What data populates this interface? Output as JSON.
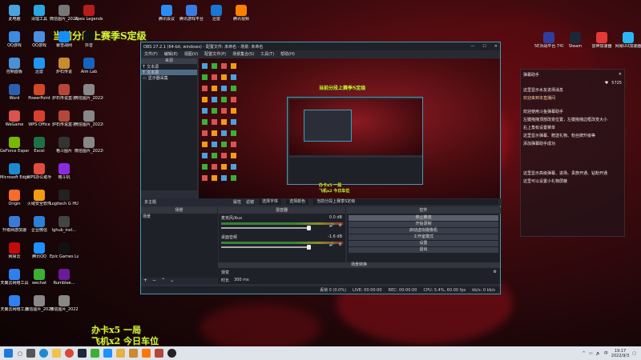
{
  "desktop_icons": [
    {
      "label": "此电脑",
      "color": "#4aa3df",
      "x": 0,
      "y": 0
    },
    {
      "label": "QQ游戏",
      "color": "#3c8be0",
      "x": 0,
      "y": 1
    },
    {
      "label": "控制面板",
      "color": "#4a90d6",
      "x": 0,
      "y": 2
    },
    {
      "label": "Word",
      "color": "#2b5fb0",
      "x": 0,
      "y": 3
    },
    {
      "label": "WeGame",
      "color": "#d9534f",
      "x": 0,
      "y": 4
    },
    {
      "label": "GeForce Experience",
      "color": "#76b900",
      "x": 0,
      "y": 5
    },
    {
      "label": "Microsoft Edge",
      "color": "#1b8bd1",
      "x": 0,
      "y": 6
    },
    {
      "label": "Origin",
      "color": "#f56c2d",
      "x": 0,
      "y": 7
    },
    {
      "label": "升级网游加速",
      "color": "#3a7bd5",
      "x": 0,
      "y": 8
    },
    {
      "label": "网易云",
      "color": "#c20c0c",
      "x": 0,
      "y": 9
    },
    {
      "label": "天翼云网络工具",
      "color": "#2f80ed",
      "x": 0,
      "y": 10
    },
    {
      "label": "天翼云网络工具",
      "color": "#2f80ed",
      "x": 0,
      "y": 11
    },
    {
      "label": "清理工具",
      "color": "#2aa7e0",
      "x": 1,
      "y": 0
    },
    {
      "label": "QQ游戏",
      "color": "#4a90e2",
      "x": 1,
      "y": 1
    },
    {
      "label": "迅雷",
      "color": "#2196f3",
      "x": 1,
      "y": 2
    },
    {
      "label": "PowerPoint",
      "color": "#d24726",
      "x": 1,
      "y": 3
    },
    {
      "label": "WPS Office",
      "color": "#d6402f",
      "x": 1,
      "y": 4
    },
    {
      "label": "Excel",
      "color": "#1e7145",
      "x": 1,
      "y": 5
    },
    {
      "label": "WPS办公助手",
      "color": "#e14c3e",
      "x": 1,
      "y": 6
    },
    {
      "label": "火绒安全软件",
      "color": "#f39c12",
      "x": 1,
      "y": 7
    },
    {
      "label": "企业微信",
      "color": "#2b80d8",
      "x": 1,
      "y": 8
    },
    {
      "label": "腾讯QQ",
      "color": "#1e90ff",
      "x": 1,
      "y": 9
    },
    {
      "label": "wechat",
      "color": "#3cb034",
      "x": 1,
      "y": 10
    },
    {
      "label": "微信图片_2022",
      "color": "#888888",
      "x": 1,
      "y": 11
    },
    {
      "label": "微信图片_2022012...",
      "color": "#777777",
      "x": 2,
      "y": 0
    },
    {
      "label": "暴雪战网",
      "color": "#148eff",
      "x": 2,
      "y": 1
    },
    {
      "label": "炉石传说",
      "color": "#c98b2e",
      "x": 2,
      "y": 2
    },
    {
      "label": "炉石传说盒子",
      "color": "#b5473a",
      "x": 2,
      "y": 3
    },
    {
      "label": "炉石传说盒子",
      "color": "#b5473a",
      "x": 2,
      "y": 4
    },
    {
      "label": "格斗图片",
      "color": "#333333",
      "x": 2,
      "y": 5
    },
    {
      "label": "格斗机",
      "color": "#8a2be2",
      "x": 2,
      "y": 6
    },
    {
      "label": "Logitech G HUB",
      "color": "#222222",
      "x": 2,
      "y": 7
    },
    {
      "label": "lghub_inst...",
      "color": "#444444",
      "x": 2,
      "y": 8
    },
    {
      "label": "Epic Games Launcher",
      "color": "#111111",
      "x": 2,
      "y": 9
    },
    {
      "label": "Rumblee...",
      "color": "#6a1b9a",
      "x": 2,
      "y": 10
    },
    {
      "label": "微信图片_2022",
      "color": "#888888",
      "x": 2,
      "y": 11
    },
    {
      "label": "Apex Legends",
      "color": "#b71c1c",
      "x": 3,
      "y": 0
    },
    {
      "label": "抖音",
      "color": "#111111",
      "x": 3,
      "y": 1
    },
    {
      "label": "Aim Lab",
      "color": "#1565c0",
      "x": 3,
      "y": 2
    },
    {
      "label": "微信图片_2022082...",
      "color": "#888888",
      "x": 3,
      "y": 3
    },
    {
      "label": "微信图片_2022082...",
      "color": "#888888",
      "x": 3,
      "y": 4
    },
    {
      "label": "微信图片_2022082...",
      "color": "#888888",
      "x": 3,
      "y": 5
    }
  ],
  "top_icons": [
    {
      "label": "腾讯会议",
      "color": "#2c8cf4"
    },
    {
      "label": "腾讯游戏平台",
      "color": "#3a7be0"
    },
    {
      "label": "迅雷",
      "color": "#1976d2"
    },
    {
      "label": "腾讯视频",
      "color": "#ff7f00"
    }
  ],
  "right_icons": [
    {
      "label": "5E对战平台 741",
      "color": "#2f3e9e"
    },
    {
      "label": "Steam",
      "color": "#1b2838"
    },
    {
      "label": "雷神加速器",
      "color": "#e53935"
    },
    {
      "label": "网易UU加速器",
      "color": "#29b6f6"
    }
  ],
  "overlay": {
    "title": "当前分段上赛季S定级",
    "line1": "办卡x5 一局",
    "line2": "飞机x2 今日车位"
  },
  "obs": {
    "title": "OBS 27.2.1 (64-bit, windows) - 配置文件: 未命名 - 场景: 未命名",
    "menu": [
      "文件(F)",
      "编辑(E)",
      "视图(V)",
      "配置文件(P)",
      "场景集合(S)",
      "工具(T)",
      "帮助(H)"
    ],
    "sources_header": "来源",
    "sources": [
      {
        "label": "文本源",
        "selected": false
      },
      {
        "label": "文本源",
        "selected": true
      },
      {
        "label": "显示器采集",
        "selected": false
      }
    ],
    "scene_bar": {
      "current": "多主题",
      "properties": "属性",
      "filters": "滤镜",
      "pick_font": "选择字体",
      "pick_color": "选择颜色",
      "text": "当前分段上赛季S定级"
    },
    "dock_headers": [
      "场景",
      "混音器",
      "控件"
    ],
    "scenes": [
      "场景"
    ],
    "mixer": [
      {
        "name": "麦克风/Aux",
        "db": "0.0 dB"
      },
      {
        "name": "桌面音频",
        "db": "-1.6 dB"
      }
    ],
    "controls": [
      "停止推流",
      "开始录制",
      "启动虚拟摄像机",
      "工作室模式",
      "设置",
      "退出"
    ],
    "transitions_header": "场景转换",
    "transition": "渐变",
    "duration_label": "时长",
    "duration": "300 ms",
    "status": [
      "丢帧 0 (0.0%)",
      "LIVE: 00:00:00",
      "REC: 00:00:00",
      "CPU: 5.4%, 60.00 fps",
      "kb/s: 0 kb/s"
    ]
  },
  "chat": {
    "header": "弹幕助手",
    "line1": "这里显示水友进场消息",
    "line2": "欢迎来到本直播间",
    "line3": "欢迎使用斗鱼弹幕助手",
    "line4": "左键拖拽顶部改变位置，左键拖拽边框改变大小",
    "line5": "右上角有设置菜单",
    "line6": "这里显示弹幕、赠送礼物、粉丝牌升级等",
    "line7": "添加弹幕助手成功",
    "line8": "这里显示高级弹幕、进场、贵族开通、钻粉开通",
    "line9": "这里可以设置小礼物屏蔽",
    "online": "5725"
  },
  "taskbar": {
    "search": "○",
    "time": "19:17",
    "date": "2022/9/3",
    "lang": "中"
  }
}
